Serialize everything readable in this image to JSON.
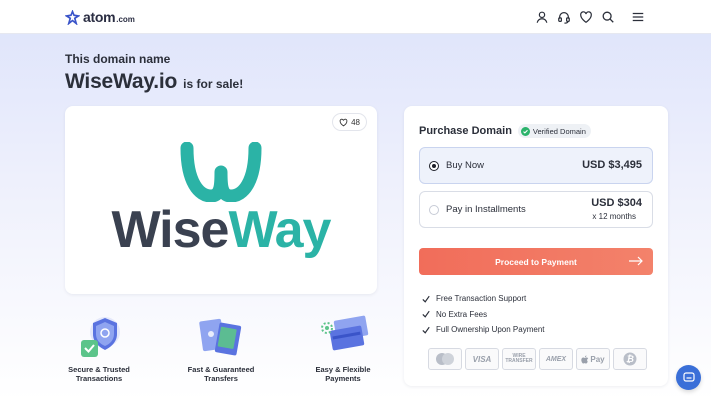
{
  "header": {
    "logo_text": "atom",
    "logo_sub": ".com",
    "icons": [
      "user-icon",
      "headset-icon",
      "heart-icon",
      "search-icon",
      "menu-icon"
    ]
  },
  "hero": {
    "subtitle": "This domain name",
    "domain": "WiseWay.io",
    "for_sale": "is for sale!"
  },
  "logo_card": {
    "likes": "48",
    "brand_part1": "Wise",
    "brand_part2": "Way"
  },
  "features": [
    {
      "label_line1": "Secure & Trusted",
      "label_line2": "Transactions"
    },
    {
      "label_line1": "Fast & Guaranteed",
      "label_line2": "Transfers"
    },
    {
      "label_line1": "Easy & Flexible",
      "label_line2": "Payments"
    }
  ],
  "purchase": {
    "title": "Purchase Domain",
    "verified": "Verified Domain",
    "options": [
      {
        "label": "Buy Now",
        "price": "USD $3,495",
        "sub": "",
        "selected": true
      },
      {
        "label": "Pay in Installments",
        "price": "USD $304",
        "sub": "x 12 months",
        "selected": false
      }
    ],
    "proceed_label": "Proceed to Payment",
    "benefits": [
      "Free Transaction Support",
      "No Extra Fees",
      "Full Ownership Upon Payment"
    ],
    "payment_methods": [
      "Mastercard",
      "VISA",
      "Wire Transfer",
      "AMEX",
      "Apple Pay",
      "Bitcoin"
    ],
    "payment_text": {
      "visa": "VISA",
      "wire1": "WIRE",
      "wire2": "TRANSFER",
      "amex": "AMEX",
      "applepay": "Pay"
    }
  },
  "colors": {
    "accent": "#f16d5a",
    "brand_teal": "#2bb3a6",
    "brand_dark": "#3a4150",
    "verified_green": "#2bb36b",
    "chat_blue": "#3a6fd8"
  }
}
